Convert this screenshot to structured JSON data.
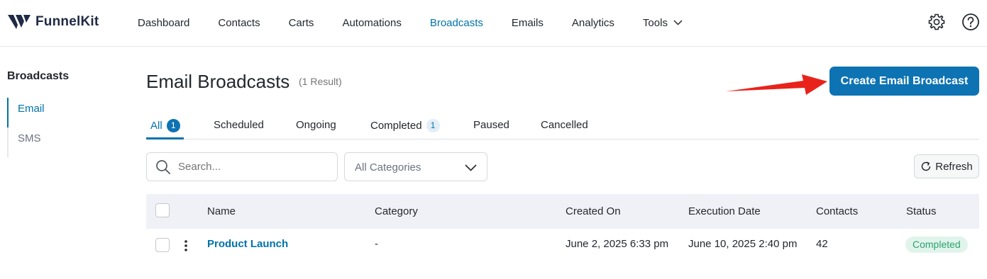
{
  "app": {
    "brand": "FunnelKit",
    "accent_color": "#0d73b3",
    "logo_icon": "funnelkit-logo-icon"
  },
  "nav": {
    "items": [
      {
        "label": "Dashboard"
      },
      {
        "label": "Contacts"
      },
      {
        "label": "Carts"
      },
      {
        "label": "Automations"
      },
      {
        "label": "Broadcasts",
        "active": true
      },
      {
        "label": "Emails"
      },
      {
        "label": "Analytics"
      },
      {
        "label": "Tools",
        "dropdown": true
      }
    ],
    "icons": [
      "gear-icon",
      "help-icon"
    ]
  },
  "sidebar": {
    "title": "Broadcasts",
    "items": [
      {
        "label": "Email",
        "active": true
      },
      {
        "label": "SMS"
      }
    ]
  },
  "header": {
    "title": "Email Broadcasts",
    "result_count": "(1 Result)",
    "create_button": "Create Email Broadcast"
  },
  "tabs": [
    {
      "label": "All",
      "count": "1",
      "active": true
    },
    {
      "label": "Scheduled"
    },
    {
      "label": "Ongoing"
    },
    {
      "label": "Completed",
      "count": "1"
    },
    {
      "label": "Paused"
    },
    {
      "label": "Cancelled"
    }
  ],
  "filters": {
    "search_placeholder": "Search...",
    "category_value": "All Categories",
    "refresh_label": "Refresh"
  },
  "table": {
    "columns": [
      "Name",
      "Category",
      "Created On",
      "Execution Date",
      "Contacts",
      "Status"
    ],
    "rows": [
      {
        "name": "Product Launch",
        "category": "-",
        "created_on": "June 2, 2025 6:33 pm",
        "execution_date": "June 10, 2025 2:40 pm",
        "contacts": "42",
        "status": "Completed"
      }
    ]
  },
  "colors": {
    "status_completed_bg": "#e0f4ec",
    "status_completed_text": "#2ba36b",
    "annotation_arrow": "#e8231b"
  }
}
